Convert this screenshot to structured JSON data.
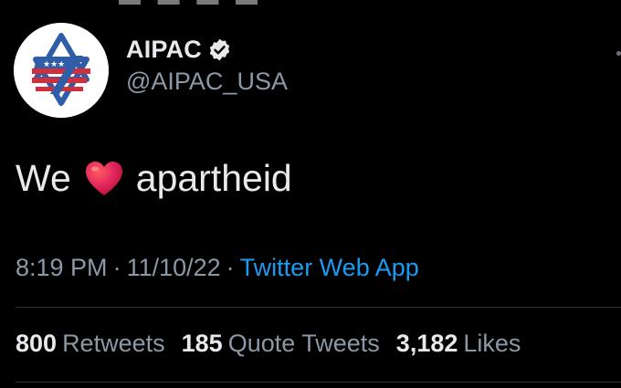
{
  "author": {
    "display_name": "AIPAC",
    "handle": "@AIPAC_USA",
    "verified_icon": "verified-badge-icon",
    "avatar_icon": "aipac-star-flag-logo"
  },
  "tweet": {
    "text_before": "We",
    "emoji": "red-heart-emoji",
    "text_after": "apartheid"
  },
  "meta": {
    "time": "8:19 PM",
    "separator": "·",
    "date": "11/10/22",
    "source": "Twitter Web App"
  },
  "stats": {
    "retweets": {
      "count": "800",
      "label": "Retweets"
    },
    "quote_tweets": {
      "count": "185",
      "label": "Quote Tweets"
    },
    "likes": {
      "count": "3,182",
      "label": "Likes"
    }
  },
  "colors": {
    "background": "#000000",
    "primary_text": "#e7e9ea",
    "secondary_text": "#8b98a5",
    "link": "#1d9bf0",
    "divider": "#2f3336",
    "heart": "#e0245e",
    "logo_blue": "#2f5da8",
    "logo_red": "#d22f3c"
  }
}
